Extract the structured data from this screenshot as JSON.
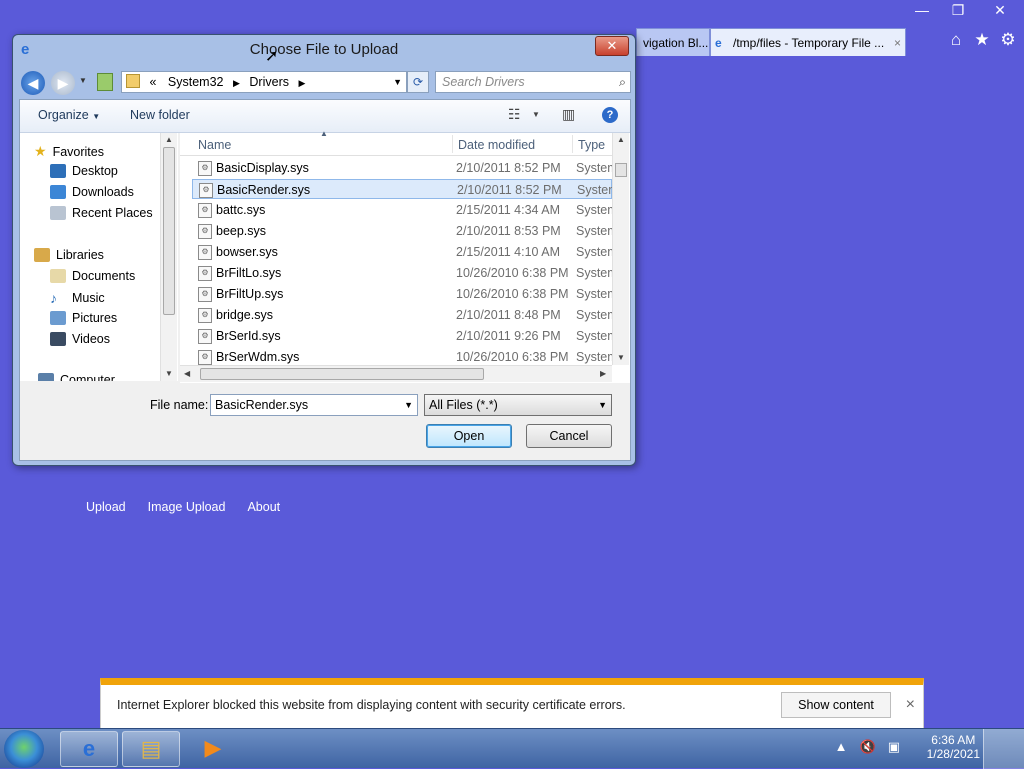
{
  "ie": {
    "tabs": [
      {
        "label": "vigation Bl..."
      },
      {
        "label": "/tmp/files - Temporary File ..."
      }
    ],
    "tab_close": "×",
    "controls": {
      "minimize": "—",
      "restore": "❐",
      "close": "✕"
    },
    "icons": {
      "home": "⌂",
      "favorites": "★",
      "tools": "⚙"
    }
  },
  "page": {
    "links": [
      "Upload",
      "Image Upload",
      "About"
    ]
  },
  "dialog": {
    "title": "Choose File to Upload",
    "close": "✕",
    "address": {
      "prefix": "«",
      "segments": [
        "System32",
        "Drivers"
      ]
    },
    "search_placeholder": "Search Drivers",
    "toolbar": {
      "organize": "Organize",
      "new_folder": "New folder",
      "help": "?"
    },
    "nav": {
      "favorites": "Favorites",
      "favorites_items": [
        "Desktop",
        "Downloads",
        "Recent Places"
      ],
      "libraries": "Libraries",
      "libraries_items": [
        "Documents",
        "Music",
        "Pictures",
        "Videos"
      ],
      "computer": "Computer"
    },
    "columns": {
      "name": "Name",
      "date": "Date modified",
      "type": "Type"
    },
    "files": [
      {
        "name": "BasicDisplay.sys",
        "date": "2/10/2011 8:52 PM",
        "type": "System"
      },
      {
        "name": "BasicRender.sys",
        "date": "2/10/2011 8:52 PM",
        "type": "System"
      },
      {
        "name": "battc.sys",
        "date": "2/15/2011 4:34 AM",
        "type": "System"
      },
      {
        "name": "beep.sys",
        "date": "2/10/2011 8:53 PM",
        "type": "System"
      },
      {
        "name": "bowser.sys",
        "date": "2/15/2011 4:10 AM",
        "type": "System"
      },
      {
        "name": "BrFiltLo.sys",
        "date": "10/26/2010 6:38 PM",
        "type": "System"
      },
      {
        "name": "BrFiltUp.sys",
        "date": "10/26/2010 6:38 PM",
        "type": "System"
      },
      {
        "name": "bridge.sys",
        "date": "2/10/2011 8:48 PM",
        "type": "System"
      },
      {
        "name": "BrSerId.sys",
        "date": "2/10/2011 9:26 PM",
        "type": "System"
      },
      {
        "name": "BrSerWdm.sys",
        "date": "10/26/2010 6:38 PM",
        "type": "System"
      }
    ],
    "selected_index": 1,
    "filename_label": "File name:",
    "filename_value": "BasicRender.sys",
    "filetype_value": "All Files (*.*)",
    "open": "Open",
    "cancel": "Cancel"
  },
  "notification": {
    "message": "Internet Explorer blocked this website from displaying content with security certificate errors.",
    "button": "Show content",
    "close": "×"
  },
  "taskbar": {
    "time": "6:36 AM",
    "date": "1/28/2021"
  },
  "colors": {
    "desktop": "#5a5ad9",
    "accent": "#f0a30a",
    "selection": "#dceafb"
  }
}
